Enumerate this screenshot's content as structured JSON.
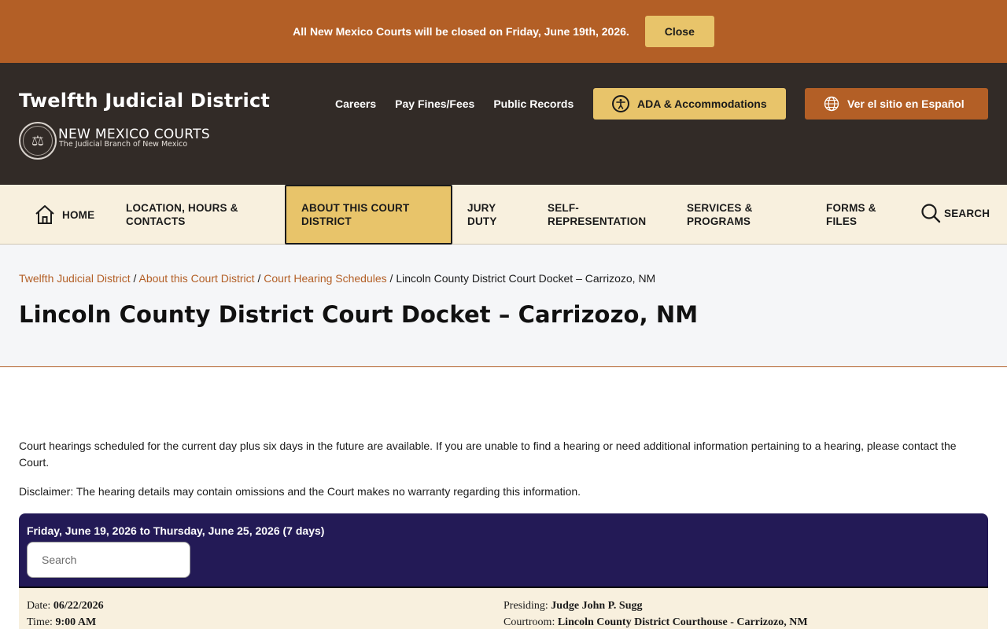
{
  "alert": {
    "message": "All New Mexico Courts will be closed on Friday, June 19th, 2026.",
    "close_label": "Close"
  },
  "header": {
    "site_title": "Twelfth Judicial District",
    "brand_name": "NEW MEXICO COURTS",
    "brand_tagline": "The Judicial Branch of New Mexico",
    "util_links": [
      "Careers",
      "Pay Fines/Fees",
      "Public Records"
    ],
    "ada_label": "ADA & Accommodations",
    "spanish_label": "Ver el sitio en Español"
  },
  "nav": {
    "home": "HOME",
    "location": [
      "LOCATION, HOURS &",
      "CONTACTS"
    ],
    "about": [
      "ABOUT THIS COURT",
      "DISTRICT"
    ],
    "jury": [
      "JURY",
      "DUTY"
    ],
    "self_rep": [
      "SELF-",
      "REPRESENTATION"
    ],
    "services": [
      "SERVICES &",
      "PROGRAMS"
    ],
    "forms": [
      "FORMS &",
      "FILES"
    ],
    "search": "SEARCH"
  },
  "breadcrumb": {
    "items": [
      "Twelfth Judicial District",
      "About this Court District",
      "Court Hearing Schedules"
    ],
    "current": "Lincoln County District Court Docket – Carrizozo, NM",
    "separator": " / "
  },
  "page_title": "Lincoln County District Court Docket – Carrizozo, NM",
  "content": {
    "intro": "Court hearings scheduled for the current day plus six days in the future are available. If you are unable to find a hearing or need additional information pertaining to a hearing, please contact the Court.",
    "disclaimer": "Disclaimer:  The hearing details may contain omissions and the Court makes no warranty regarding this information."
  },
  "docket": {
    "range_label": "Friday, June 19, 2026 to Thursday, June 25, 2026 (7 days)",
    "search_placeholder": "Search",
    "entries": [
      {
        "date_label": "Date:",
        "date": "06/22/2026",
        "time_label": "Time:",
        "time": "9:00 AM",
        "presiding_label": "Presiding:",
        "presiding": "Judge John P. Sugg",
        "courtroom_label": "Courtroom:",
        "courtroom": "Lincoln County District Courthouse - Carrizozo, NM"
      }
    ]
  },
  "colors": {
    "alert_bg": "#b35f26",
    "header_bg": "#322b27",
    "accent_gold": "#e8c46a",
    "nav_bg": "#f8f0de",
    "docket_head": "#231a56",
    "link": "#b35f26"
  }
}
